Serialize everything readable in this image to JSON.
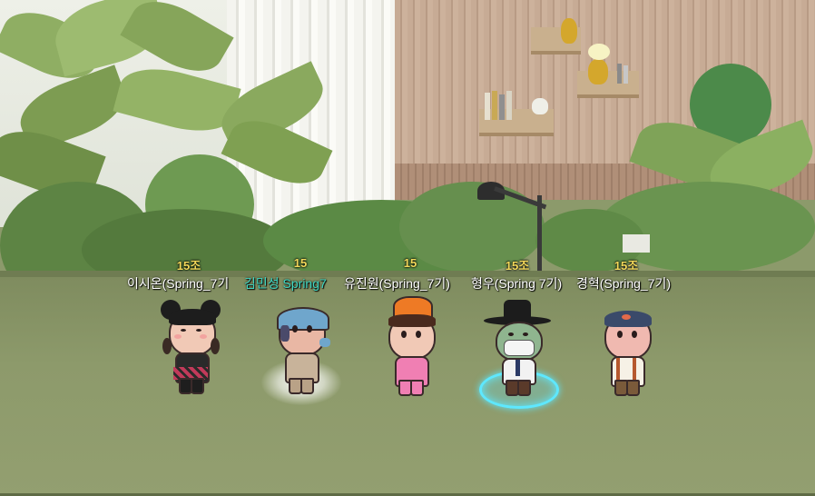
{
  "players": [
    {
      "level": "15조",
      "name": "이시온(Spring_7기"
    },
    {
      "level": "15",
      "name": "김민성 Spring7"
    },
    {
      "level": "15",
      "name": "유진원(Spring_7기)"
    },
    {
      "level": "15조",
      "name": "형우(Spring 7기)"
    },
    {
      "level": "15조",
      "name": "경혁(Spring_7기)"
    }
  ],
  "colors": {
    "level_text": "#f2d85a",
    "name_text": "#ffffff",
    "highlight_name": "#3fd8c3",
    "ground": "#8d9a6b",
    "selection_ring_white": "#ffffff",
    "selection_ring_cyan": "#5ee8ff"
  }
}
